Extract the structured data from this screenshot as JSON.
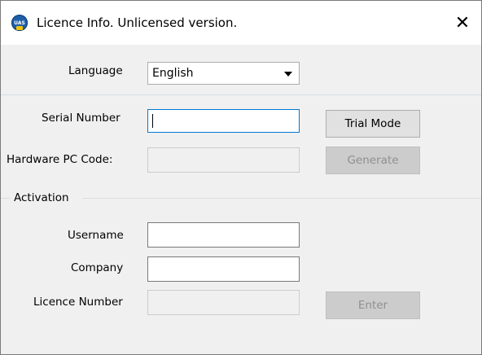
{
  "window": {
    "title": "Licence Info. Unlicensed version.",
    "close_symbol": "✕",
    "app_icon_text": "UAS"
  },
  "language": {
    "label": "Language",
    "selected": "English"
  },
  "serial": {
    "label": "Serial Number",
    "value": "",
    "trial_button": "Trial Mode"
  },
  "hardware": {
    "label": "Hardware PC Code:",
    "value": "",
    "generate_button": "Generate"
  },
  "activation": {
    "group_label": "Activation",
    "username_label": "Username",
    "username_value": "",
    "company_label": "Company",
    "company_value": "",
    "licence_label": "Licence Number",
    "licence_value": "",
    "enter_button": "Enter"
  },
  "icons": [
    "app-logo-icon",
    "close-icon",
    "dropdown-arrow-icon"
  ],
  "colors": {
    "window_bg": "#f0f0f0",
    "titlebar_bg": "#ffffff",
    "focus_border": "#0078d7",
    "disabled_button_bg": "#cccccc"
  }
}
